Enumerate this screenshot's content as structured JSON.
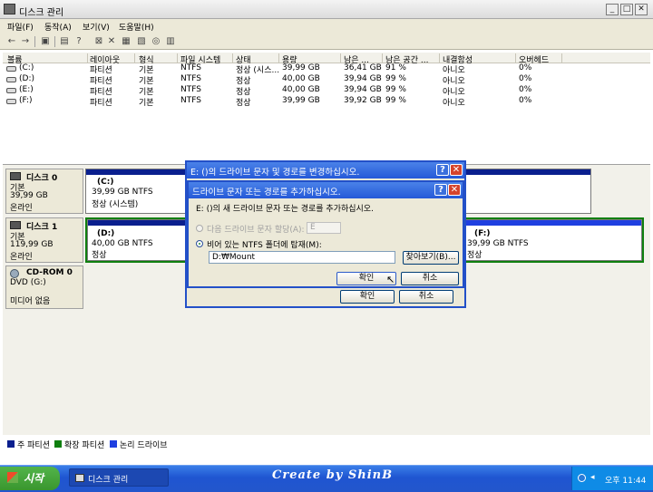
{
  "window": {
    "title": "디스크 관리"
  },
  "menu": [
    "파일(F)",
    "동작(A)",
    "보기(V)",
    "도움말(H)"
  ],
  "volume_list": {
    "columns": [
      "볼륨",
      "레이아웃",
      "형식",
      "파일 시스템",
      "상태",
      "용량",
      "남은 ...",
      "남은 공간 ...",
      "내결함성",
      "오버헤드"
    ],
    "rows": [
      [
        "(C:)",
        "파티션",
        "기본",
        "NTFS",
        "정상 (시스...",
        "39,99 GB",
        "36,41 GB",
        "91 %",
        "아니오",
        "0%"
      ],
      [
        "(D:)",
        "파티션",
        "기본",
        "NTFS",
        "정상",
        "40,00 GB",
        "39,94 GB",
        "99 %",
        "아니오",
        "0%"
      ],
      [
        "(E:)",
        "파티션",
        "기본",
        "NTFS",
        "정상",
        "40,00 GB",
        "39,94 GB",
        "99 %",
        "아니오",
        "0%"
      ],
      [
        "(F:)",
        "파티션",
        "기본",
        "NTFS",
        "정상",
        "39,99 GB",
        "39,92 GB",
        "99 %",
        "아니오",
        "0%"
      ]
    ]
  },
  "disks": {
    "disk0": {
      "name": "디스크 0",
      "type": "기본",
      "size": "39,99 GB",
      "status": "온라인",
      "partition": {
        "name": "(C:)",
        "size": "39,99 GB NTFS",
        "status": "정상 (시스템)"
      }
    },
    "disk1": {
      "name": "디스크 1",
      "type": "기본",
      "size": "119,99 GB",
      "status": "온라인",
      "part_d": {
        "name": "(D:)",
        "size": "40,00 GB NTFS",
        "status": "정상"
      },
      "part_f": {
        "name": "(F:)",
        "size": "39,99 GB NTFS",
        "status": "정상"
      }
    },
    "cdrom0": {
      "name": "CD-ROM 0",
      "type": "DVD (G:)",
      "status": "미디어 없음"
    }
  },
  "legend": [
    {
      "label": "주 파티션",
      "color": "#0a1f8e"
    },
    {
      "label": "확장 파티션",
      "color": "#0f7f0f"
    },
    {
      "label": "논리 드라이브",
      "color": "#1f3fe0"
    }
  ],
  "dialog_outer": {
    "title": "E: ()의 드라이브 문자 및 경로를 변경하십시오.",
    "ok_label": "확인",
    "cancel_label": "취소"
  },
  "dialog_inner": {
    "title": "드라이브 문자 또는 경로를 추가하십시오.",
    "description": "E: ()의 새 드라이브 문자 또는 경로를 추가하십시오.",
    "option_letter": "다음 드라이브 문자 할당(A):",
    "letter_value": "E",
    "option_folder": "비어 있는 NTFS 폴더에 탑재(M):",
    "path_value": "D:₩Mount",
    "browse_label": "찾아보기(B)...",
    "ok_label": "확인",
    "cancel_label": "취소"
  },
  "taskbar": {
    "start_label": "시작",
    "task_label": "디스크 관리",
    "center_text": "Create by ShinB",
    "clock": "오후 11:44"
  }
}
